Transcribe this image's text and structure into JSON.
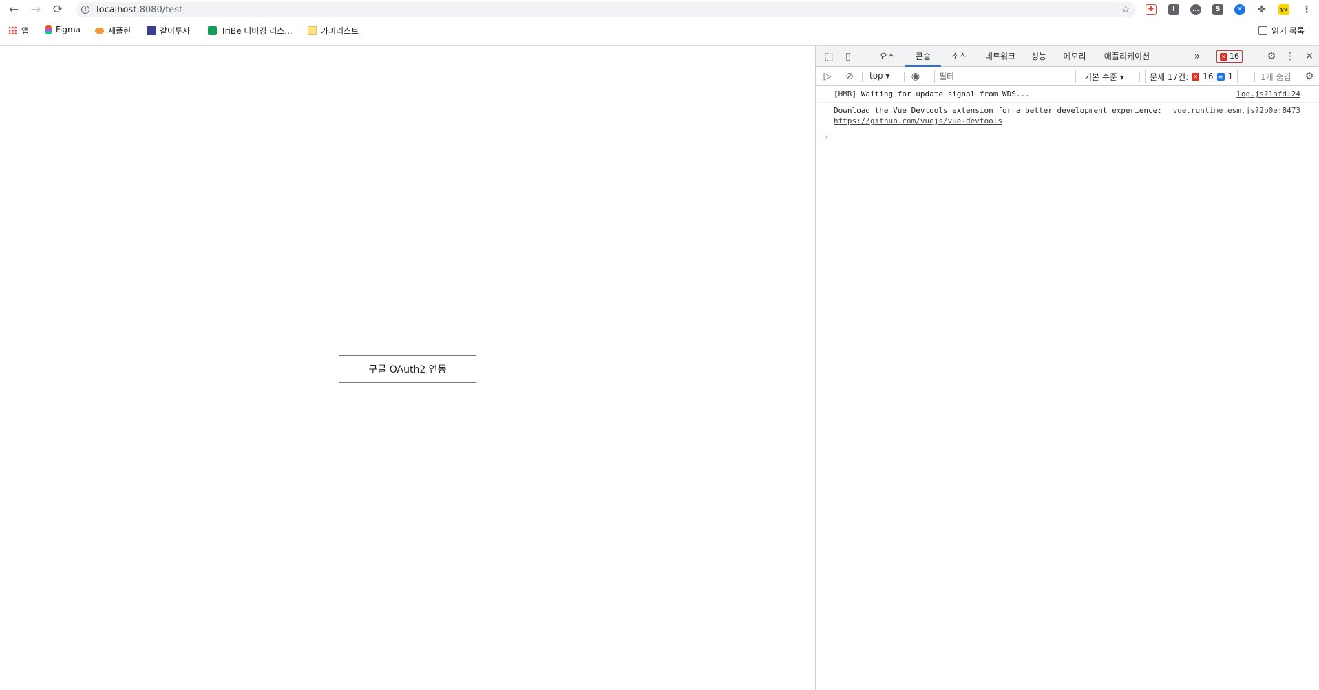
{
  "browser": {
    "url_host": "localhost",
    "url_path": ":8080/test",
    "extensions": [
      {
        "name": "puzzle-cross-icon",
        "color": "#e94235"
      },
      {
        "name": "extension-i-icon",
        "color": "#5f6368"
      },
      {
        "name": "chat-icon",
        "color": "#5f6368"
      },
      {
        "name": "extension-s-icon",
        "color": "#5f6368"
      },
      {
        "name": "extension-blue-icon",
        "color": "#1a73e8"
      },
      {
        "name": "extensions-puzzle-icon",
        "color": "#5f6368"
      },
      {
        "name": "extension-yellow-icon",
        "color": "#f9d400"
      }
    ]
  },
  "bookmarks": {
    "apps": "앱",
    "figma": "Figma",
    "item2": "제플린",
    "item3": "같이투자",
    "item4": "TriBe 디버깅 리스...",
    "item5": "카피리스트",
    "reading_list": "읽기 목록"
  },
  "page": {
    "button_label": "구글 OAuth2 연동"
  },
  "devtools": {
    "tabs": [
      "요소",
      "콘솔",
      "소스",
      "네트워크",
      "성능",
      "메모리",
      "애플리케이션"
    ],
    "active_tab": "콘솔",
    "more": "»",
    "error_count": "16",
    "context": "top",
    "filter_placeholder": "필터",
    "levels": "기본 수준",
    "issues_label": "문제 17건:",
    "issues_errors": "16",
    "issues_info": "1",
    "hidden": "1개 숨김",
    "messages": [
      {
        "text": "[HMR] Waiting for update signal from WDS...",
        "source": "log.js?1afd:24"
      },
      {
        "text": "Download the Vue Devtools extension for a better development experience:",
        "link": "https://github.com/vuejs/vue-devtools",
        "source": "vue.runtime.esm.js?2b0e:8473"
      }
    ],
    "prompt": "›"
  }
}
